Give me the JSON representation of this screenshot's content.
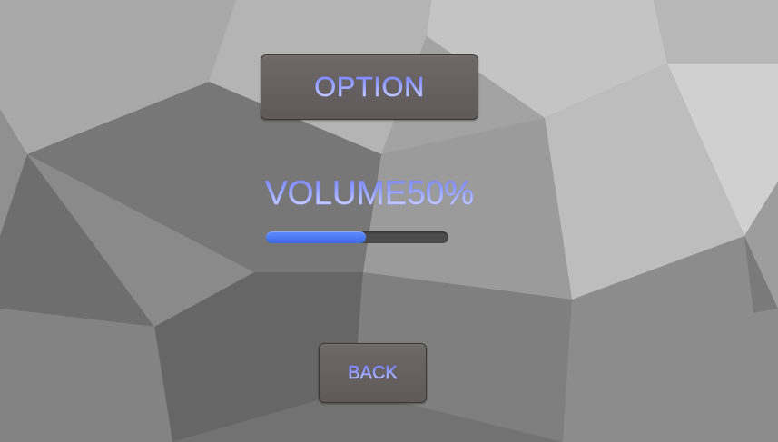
{
  "screen": {
    "title": "OPTION",
    "volume_label": "VOLUME50%",
    "volume_value": 0.5,
    "back_label": "BACK"
  },
  "colors": {
    "text_gradient_top": "#6f7dff",
    "text_gradient_bottom": "#e4e7ff",
    "slider_fill": "#4a78f2",
    "slider_track": "#4c4c4c",
    "button_face": "#665f5f"
  }
}
